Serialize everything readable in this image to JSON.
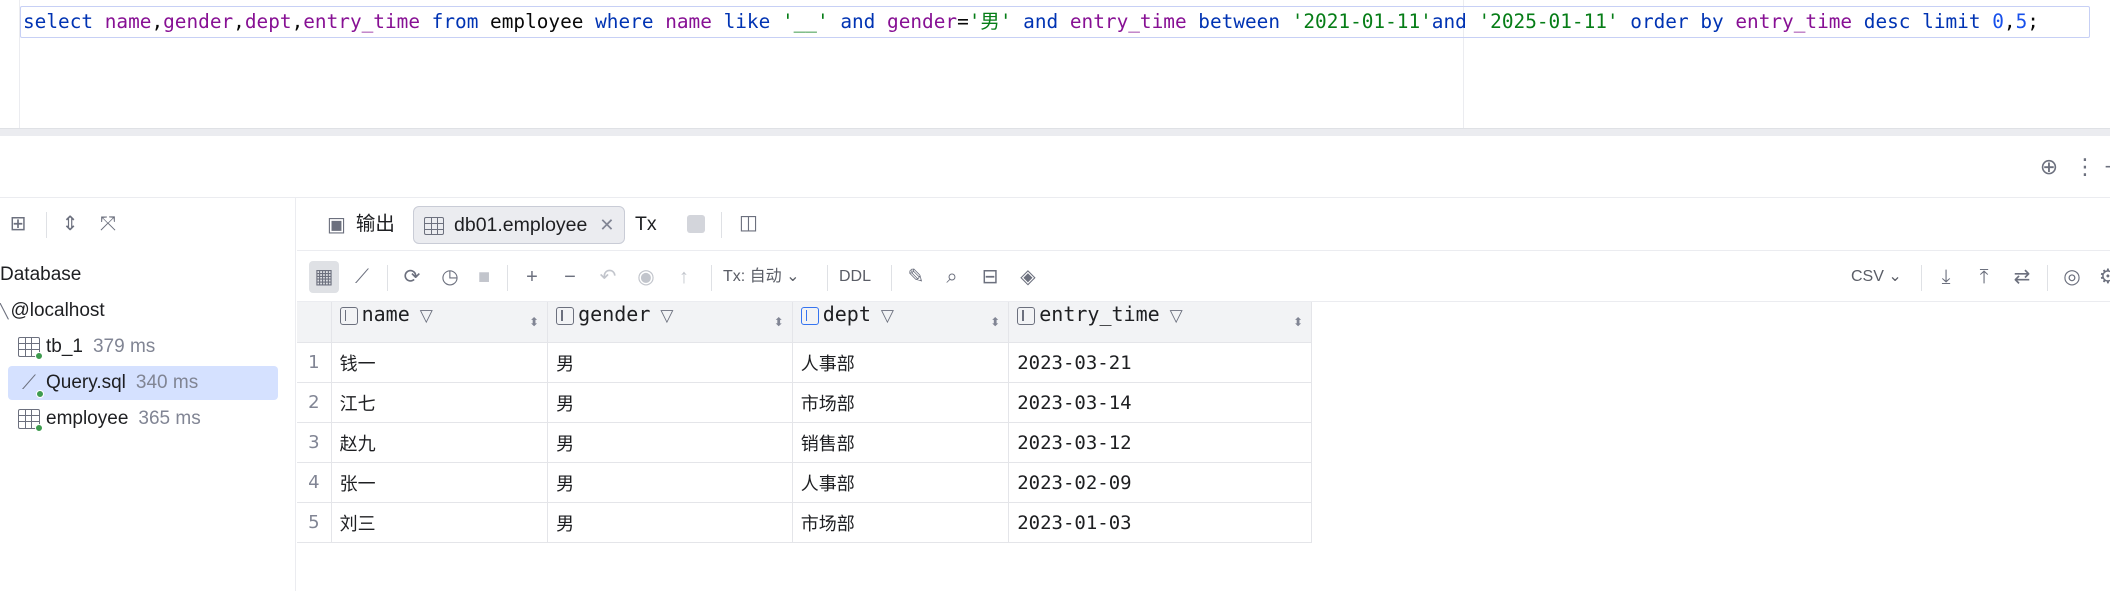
{
  "editor": {
    "sql_tokens": [
      {
        "t": "select ",
        "c": "kw"
      },
      {
        "t": "name",
        "c": "fld"
      },
      {
        "t": ",",
        "c": "plain"
      },
      {
        "t": "gender",
        "c": "fld"
      },
      {
        "t": ",",
        "c": "plain"
      },
      {
        "t": "dept",
        "c": "fld"
      },
      {
        "t": ",",
        "c": "plain"
      },
      {
        "t": "entry_time",
        "c": "fld"
      },
      {
        "t": " from ",
        "c": "kw"
      },
      {
        "t": "employee",
        "c": "plain"
      },
      {
        "t": " where ",
        "c": "kw"
      },
      {
        "t": "name",
        "c": "fld"
      },
      {
        "t": " like ",
        "c": "kw"
      },
      {
        "t": "'__'",
        "c": "str"
      },
      {
        "t": " and ",
        "c": "kw"
      },
      {
        "t": "gender",
        "c": "fld"
      },
      {
        "t": "=",
        "c": "plain"
      },
      {
        "t": "'男'",
        "c": "str"
      },
      {
        "t": " and ",
        "c": "kw"
      },
      {
        "t": "entry_time",
        "c": "fld"
      },
      {
        "t": " between ",
        "c": "kw"
      },
      {
        "t": "'2021-01-11'",
        "c": "str"
      },
      {
        "t": "and ",
        "c": "kw"
      },
      {
        "t": "'2025-01-11'",
        "c": "str"
      },
      {
        "t": " order by ",
        "c": "kw"
      },
      {
        "t": "entry_time",
        "c": "fld"
      },
      {
        "t": " desc limit ",
        "c": "kw"
      },
      {
        "t": "0",
        "c": "num"
      },
      {
        "t": ",",
        "c": "plain"
      },
      {
        "t": "5",
        "c": "num"
      },
      {
        "t": ";",
        "c": "plain"
      }
    ]
  },
  "tree": {
    "root_label": "Database",
    "host_label": "@localhost",
    "items": [
      {
        "label": "tb_1",
        "time": "379 ms",
        "kind": "table"
      },
      {
        "label": "Query.sql",
        "time": "340 ms",
        "kind": "console"
      },
      {
        "label": "employee",
        "time": "365 ms",
        "kind": "table"
      }
    ]
  },
  "tabs": {
    "output_label": "输出",
    "active_label": "db01.employee",
    "tx_label": "Tx"
  },
  "toolbar": {
    "tx_mode": "Tx: 自动",
    "ddl_label": "DDL",
    "export_format": "CSV"
  },
  "grid": {
    "columns": [
      "name",
      "gender",
      "dept",
      "entry_time"
    ],
    "rows": [
      {
        "num": "1",
        "name": "钱一",
        "gender": "男",
        "dept": "人事部",
        "entry_time": "2023-03-21"
      },
      {
        "num": "2",
        "name": "江七",
        "gender": "男",
        "dept": "市场部",
        "entry_time": "2023-03-14"
      },
      {
        "num": "3",
        "name": "赵九",
        "gender": "男",
        "dept": "销售部",
        "entry_time": "2023-03-12"
      },
      {
        "num": "4",
        "name": "张一",
        "gender": "男",
        "dept": "人事部",
        "entry_time": "2023-02-09"
      },
      {
        "num": "5",
        "name": "刘三",
        "gender": "男",
        "dept": "市场部",
        "entry_time": "2023-01-03"
      }
    ]
  },
  "colors": {
    "keyword": "#0033b3",
    "field": "#871094",
    "string": "#067d17",
    "number": "#1750eb",
    "selection": "#d5e1ff"
  }
}
